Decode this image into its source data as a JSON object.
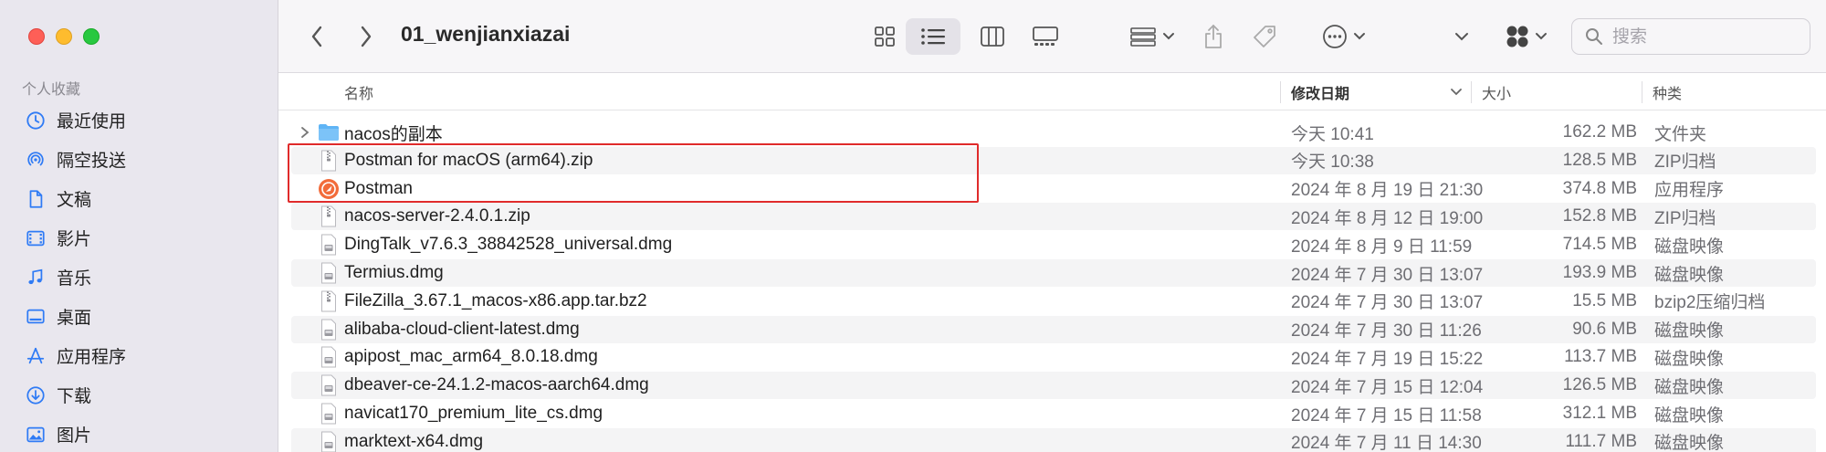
{
  "window": {
    "title": "01_wenjianxiazai"
  },
  "sidebar": {
    "section_title": "个人收藏",
    "items": [
      {
        "label": "最近使用",
        "icon": "clock-icon"
      },
      {
        "label": "隔空投送",
        "icon": "airdrop-icon"
      },
      {
        "label": "文稿",
        "icon": "document-icon"
      },
      {
        "label": "影片",
        "icon": "film-icon"
      },
      {
        "label": "音乐",
        "icon": "music-note-icon"
      },
      {
        "label": "桌面",
        "icon": "desktop-icon"
      },
      {
        "label": "应用程序",
        "icon": "applications-icon"
      },
      {
        "label": "下载",
        "icon": "download-icon"
      },
      {
        "label": "图片",
        "icon": "photo-icon"
      }
    ]
  },
  "toolbar": {
    "search_placeholder": "搜索",
    "active_view": "list"
  },
  "columns": {
    "name": "名称",
    "date": "修改日期",
    "size": "大小",
    "kind": "种类",
    "sort_column": "date",
    "sort_direction": "descending"
  },
  "files": [
    {
      "name": "nacos的副本",
      "date": "今天 10:41",
      "size": "162.2 MB",
      "kind": "文件夹",
      "icon": "folder-icon",
      "expandable": true
    },
    {
      "name": "Postman for macOS (arm64).zip",
      "date": "今天 10:38",
      "size": "128.5 MB",
      "kind": "ZIP归档",
      "icon": "zip-file-icon",
      "expandable": false
    },
    {
      "name": "Postman",
      "date": "2024 年 8 月 19 日 21:30",
      "size": "374.8 MB",
      "kind": "应用程序",
      "icon": "postman-app-icon",
      "expandable": false
    },
    {
      "name": "nacos-server-2.4.0.1.zip",
      "date": "2024 年 8 月 12 日 19:00",
      "size": "152.8 MB",
      "kind": "ZIP归档",
      "icon": "zip-file-icon",
      "expandable": false
    },
    {
      "name": "DingTalk_v7.6.3_38842528_universal.dmg",
      "date": "2024 年 8 月 9 日 11:59",
      "size": "714.5 MB",
      "kind": "磁盘映像",
      "icon": "disk-image-icon",
      "expandable": false
    },
    {
      "name": "Termius.dmg",
      "date": "2024 年 7 月 30 日 13:07",
      "size": "193.9 MB",
      "kind": "磁盘映像",
      "icon": "disk-image-icon",
      "expandable": false
    },
    {
      "name": "FileZilla_3.67.1_macos-x86.app.tar.bz2",
      "date": "2024 年 7 月 30 日 13:07",
      "size": "15.5 MB",
      "kind": "bzip2压缩归档",
      "icon": "zip-file-icon",
      "expandable": false
    },
    {
      "name": "alibaba-cloud-client-latest.dmg",
      "date": "2024 年 7 月 30 日 11:26",
      "size": "90.6 MB",
      "kind": "磁盘映像",
      "icon": "disk-image-icon",
      "expandable": false
    },
    {
      "name": "apipost_mac_arm64_8.0.18.dmg",
      "date": "2024 年 7 月 19 日 15:22",
      "size": "113.7 MB",
      "kind": "磁盘映像",
      "icon": "disk-image-icon",
      "expandable": false
    },
    {
      "name": "dbeaver-ce-24.1.2-macos-aarch64.dmg",
      "date": "2024 年 7 月 15 日 12:04",
      "size": "126.5 MB",
      "kind": "磁盘映像",
      "icon": "disk-image-icon",
      "expandable": false
    },
    {
      "name": "navicat170_premium_lite_cs.dmg",
      "date": "2024 年 7 月 15 日 11:58",
      "size": "312.1 MB",
      "kind": "磁盘映像",
      "icon": "disk-image-icon",
      "expandable": false
    },
    {
      "name": "marktext-x64.dmg",
      "date": "2024 年 7 月 11 日 14:30",
      "size": "111.7 MB",
      "kind": "磁盘映像",
      "icon": "disk-image-icon",
      "expandable": false
    }
  ],
  "annotation": {
    "highlighted_rows": [
      1,
      2
    ],
    "color": "#e02b2b"
  },
  "colors": {
    "accent": "#2f7bf5",
    "folder": "#5fb4f5",
    "postman": "#f26b3a",
    "highlight": "#e02b2b"
  }
}
